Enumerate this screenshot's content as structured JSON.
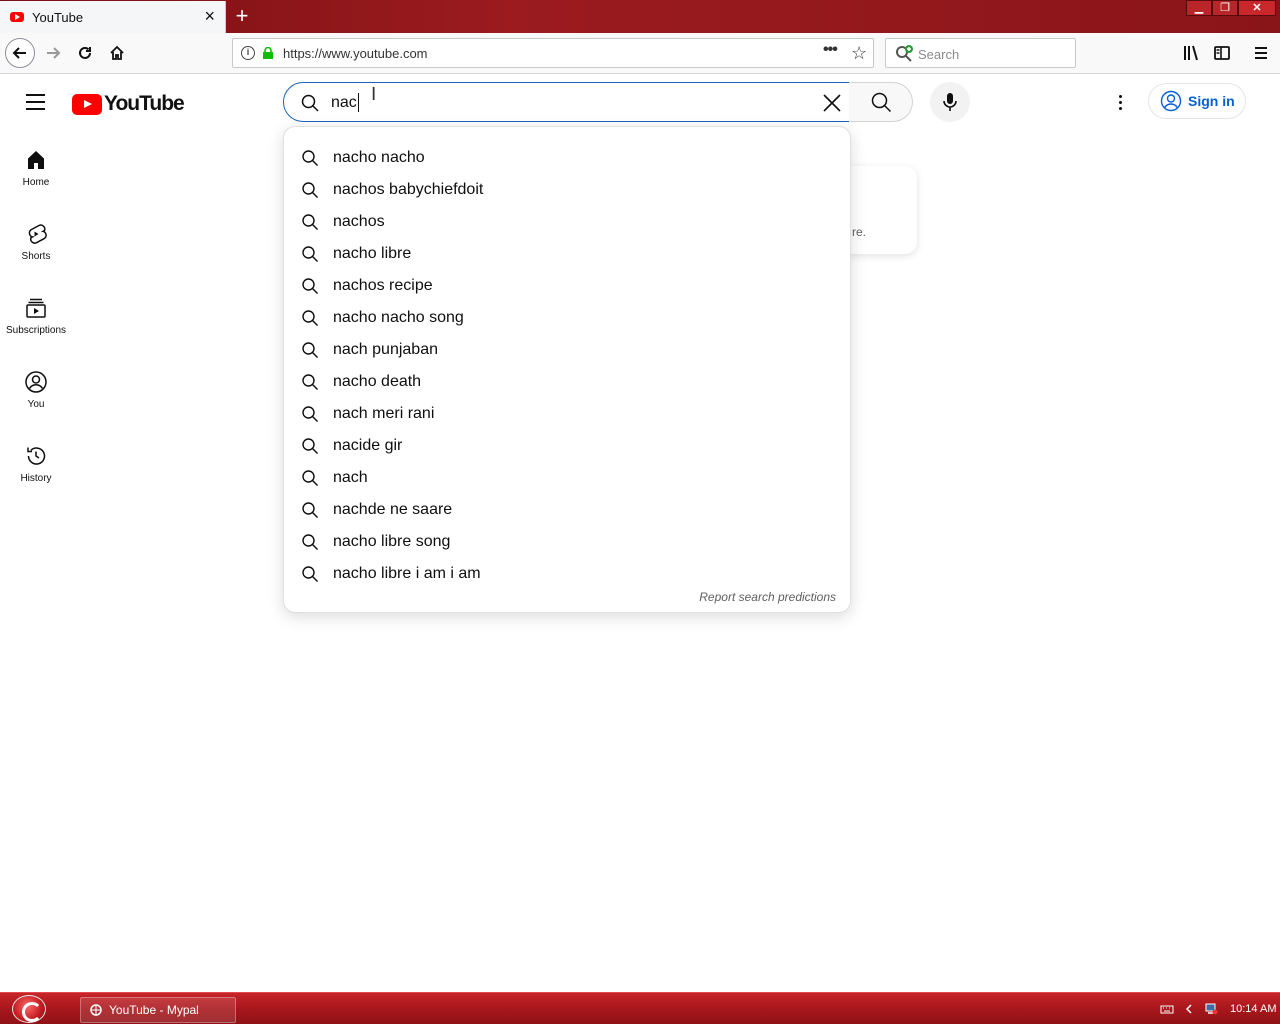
{
  "browser": {
    "tab_title": "YouTube",
    "url": "https://www.youtube.com",
    "search_placeholder": "Search"
  },
  "youtube": {
    "logo_text": "YouTube",
    "search_query": "nac",
    "sign_in_label": "Sign in",
    "guide": [
      {
        "label": "Home",
        "icon": "home-icon"
      },
      {
        "label": "Shorts",
        "icon": "shorts-icon"
      },
      {
        "label": "Subscriptions",
        "icon": "subscriptions-icon"
      },
      {
        "label": "You",
        "icon": "you-icon"
      },
      {
        "label": "History",
        "icon": "history-icon"
      }
    ],
    "background_fragment": "re.",
    "suggestions": [
      "nacho nacho",
      "nachos babychiefdoit",
      "nachos",
      "nacho libre",
      "nachos recipe",
      "nacho nacho song",
      "nach punjaban",
      "nacho death",
      "nach meri rani",
      "nacide gir",
      "nach",
      "nachde ne saare",
      "nacho libre song",
      "nacho libre i am i am"
    ],
    "report_label": "Report search predictions"
  },
  "taskbar": {
    "task_label": "YouTube - Mypal",
    "clock": "10:14 AM"
  },
  "colors": {
    "titlebar": "#9b1b1f",
    "youtube_red": "#ff0000",
    "focus_blue": "#1c62b9",
    "signin_blue": "#065fd4"
  }
}
